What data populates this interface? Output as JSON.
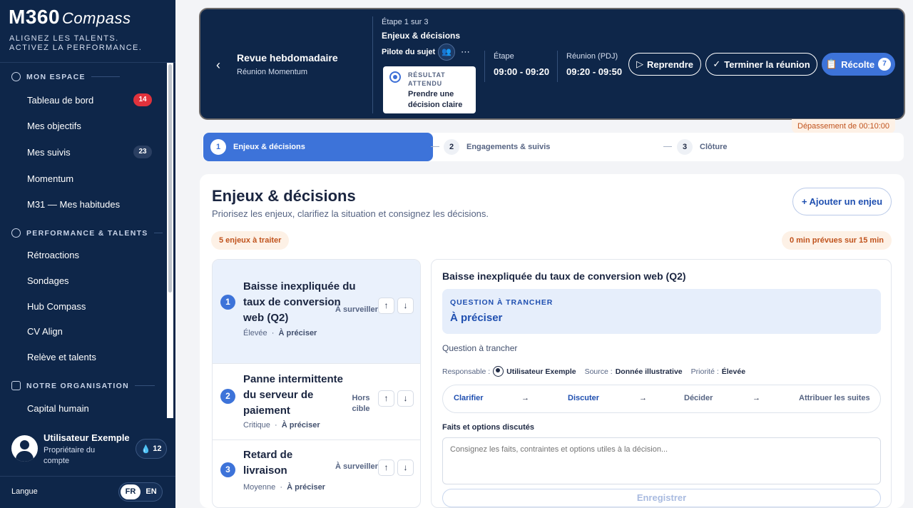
{
  "sidebar": {
    "logo_main": "M360",
    "logo_sub": "Compass",
    "tagline_1": "ALIGNEZ LES TALENTS.",
    "tagline_2": "ACTIVEZ LA PERFORMANCE.",
    "sections": [
      {
        "title": "MON ESPACE"
      },
      {
        "title": "PERFORMANCE & TALENTS"
      },
      {
        "title": "NOTRE ORGANISATION"
      }
    ],
    "items": [
      {
        "label": "Tableau de bord",
        "badge": "14"
      },
      {
        "label": "Mes objectifs"
      },
      {
        "label": "Mes suivis",
        "badge": "23"
      },
      {
        "label": "Momentum"
      },
      {
        "label": "M31 — Mes habitudes"
      },
      {
        "label": "Rétroactions"
      },
      {
        "label": "Sondages"
      },
      {
        "label": "Hub Compass"
      },
      {
        "label": "CV Align"
      },
      {
        "label": "Relève et talents"
      },
      {
        "label": "Capital humain"
      }
    ],
    "user": {
      "name": "Utilisateur Exemple",
      "role": "Propriétaire du compte",
      "streak": "12"
    },
    "language_label": "Langue",
    "languages": [
      "FR",
      "EN"
    ],
    "active_language": "FR"
  },
  "header": {
    "back_icon": "chevron-left",
    "title": "Revue hebdomadaire",
    "subtitle": "Réunion Momentum",
    "step_of": "Étape 1 sur 3",
    "step_name": "Enjeux & décisions",
    "pilot_label": "Pilote du sujet",
    "result_label": "RÉSULTAT ATTENDU",
    "result_value": "Prendre une décision claire",
    "etape_label": "Étape",
    "etape_value": "09:00 - 09:20",
    "reunion_label": "Réunion (PDJ)",
    "reunion_value": "09:20 - 09:50",
    "resume_label": "Reprendre",
    "finish_label": "Terminer la réunion",
    "harvest_label": "Récolte",
    "harvest_count": "7",
    "overrun": "Dépassement de 00:10:00"
  },
  "stepper": [
    {
      "num": "1",
      "label": "Enjeux & décisions"
    },
    {
      "num": "2",
      "label": "Engagements & suivis"
    },
    {
      "num": "3",
      "label": "Clôture"
    }
  ],
  "main": {
    "title": "Enjeux & décisions",
    "subtitle": "Priorisez les enjeux, clarifiez la situation et consignez les décisions.",
    "add_label": "Ajouter un enjeu",
    "issues_count": "5 enjeux à traiter",
    "time_planned": "0 min prévues sur 15 min",
    "issues": [
      {
        "num": "1",
        "title": "Baisse inexpliquée du taux de conversion web (Q2)",
        "priority": "Élevée",
        "state": "À préciser",
        "status": "À surveiller"
      },
      {
        "num": "2",
        "title": "Panne intermittente du serveur de paiement",
        "priority": "Critique",
        "state": "À préciser",
        "status": "Hors cible"
      },
      {
        "num": "3",
        "title": "Retard de livraison",
        "priority": "Moyenne",
        "state": "À préciser",
        "status": "À surveiller"
      }
    ],
    "detail": {
      "title": "Baisse inexpliquée du taux de conversion web (Q2)",
      "question_label": "QUESTION À TRANCHER",
      "question_value": "À préciser",
      "question_text": "Question à trancher",
      "responsable_label": "Responsable :",
      "responsable_value": "Utilisateur Exemple",
      "source_label": "Source :",
      "source_value": "Donnée illustrative",
      "priorite_label": "Priorité :",
      "priorite_value": "Élevée",
      "flow": [
        "Clarifier",
        "Discuter",
        "Décider",
        "Attribuer les suites"
      ],
      "facts_label": "Faits et options discutés",
      "facts_placeholder": "Consignez les faits, contraintes et options utiles à la décision...",
      "save_label": "Enregistrer"
    }
  },
  "colors": {
    "navy": "#0e2649",
    "accent": "#3d73d9",
    "orange": "#c0531d",
    "red_badge": "#e0323c"
  }
}
